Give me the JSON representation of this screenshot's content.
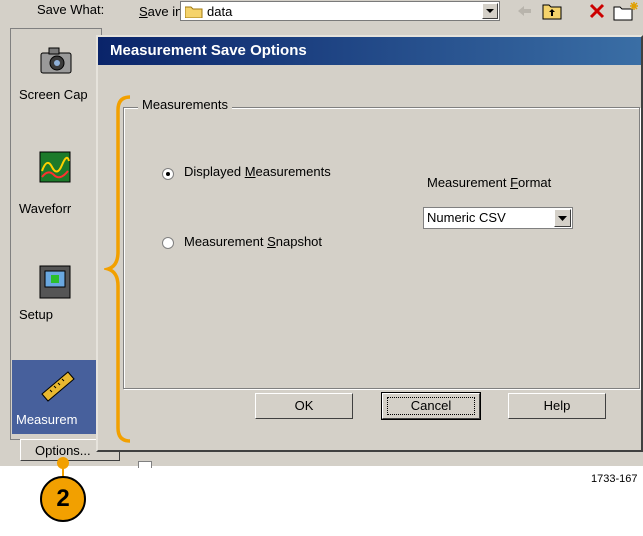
{
  "background_window": {
    "save_what_label": "Save What:",
    "save_in_label": "Save in:",
    "save_in_value": "data",
    "side_items": [
      {
        "label": "Screen Cap"
      },
      {
        "label": "Waveforr"
      },
      {
        "label": "Setup"
      },
      {
        "label": "Measurem"
      }
    ],
    "options_button": "Options..."
  },
  "dialog": {
    "title": "Measurement Save Options",
    "group_title": "Measurements",
    "radio_displayed": {
      "prefix": "Displayed ",
      "key": "M",
      "suffix": "easurements",
      "checked": true
    },
    "radio_snapshot": {
      "prefix": "Measurement ",
      "key": "S",
      "suffix": "napshot",
      "checked": false
    },
    "format_label": {
      "prefix": "Measurement ",
      "key": "F",
      "suffix": "ormat"
    },
    "format_value": "Numeric CSV",
    "buttons": {
      "ok": "OK",
      "cancel": "Cancel",
      "help": "Help"
    }
  },
  "callout": {
    "number": "2"
  },
  "figure_id": "1733-167",
  "colors": {
    "accent": "#f2a000",
    "title_bar": "#0a246a",
    "selected": "#47609c"
  }
}
